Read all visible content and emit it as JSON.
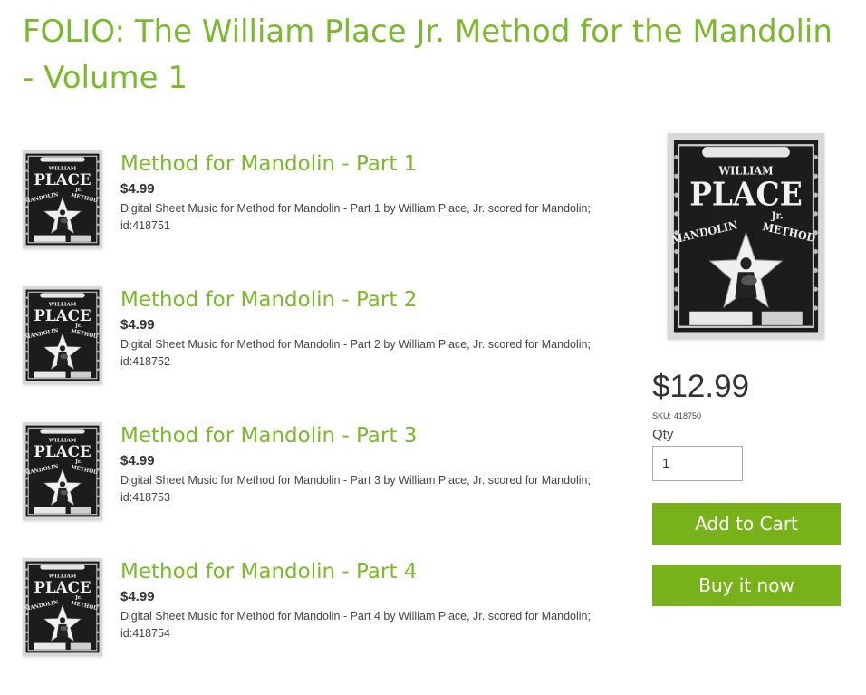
{
  "page": {
    "title": "FOLIO: The William Place Jr. Method for the Mandolin - Volume 1"
  },
  "products": [
    {
      "title": "Method for Mandolin - Part 1",
      "price": "$4.99",
      "description": "Digital Sheet Music for Method for Mandolin - Part 1 by William Place, Jr. scored for Mandolin; id:418751"
    },
    {
      "title": "Method for Mandolin - Part 2",
      "price": "$4.99",
      "description": "Digital Sheet Music for Method for Mandolin - Part 2 by William Place, Jr. scored for Mandolin; id:418752"
    },
    {
      "title": "Method for Mandolin - Part 3",
      "price": "$4.99",
      "description": "Digital Sheet Music for Method for Mandolin - Part 3 by William Place, Jr. scored for Mandolin; id:418753"
    },
    {
      "title": "Method for Mandolin - Part 4",
      "price": "$4.99",
      "description": "Digital Sheet Music for Method for Mandolin - Part 4 by William Place, Jr. scored for Mandolin; id:418754"
    }
  ],
  "cover_art": {
    "top_text": "WILLIAM",
    "main_text": "PLACE",
    "sub_text": "Jr.",
    "left_text": "MANDOLIN",
    "right_text": "METHOD"
  },
  "purchase": {
    "price": "$12.99",
    "sku_label": "SKU:",
    "sku": "418750",
    "qty_label": "Qty",
    "qty_value": "1",
    "add_to_cart_label": "Add to Cart",
    "buy_now_label": "Buy it now"
  },
  "colors": {
    "title_green": "#7cb82f",
    "button_green": "#77b21b"
  }
}
